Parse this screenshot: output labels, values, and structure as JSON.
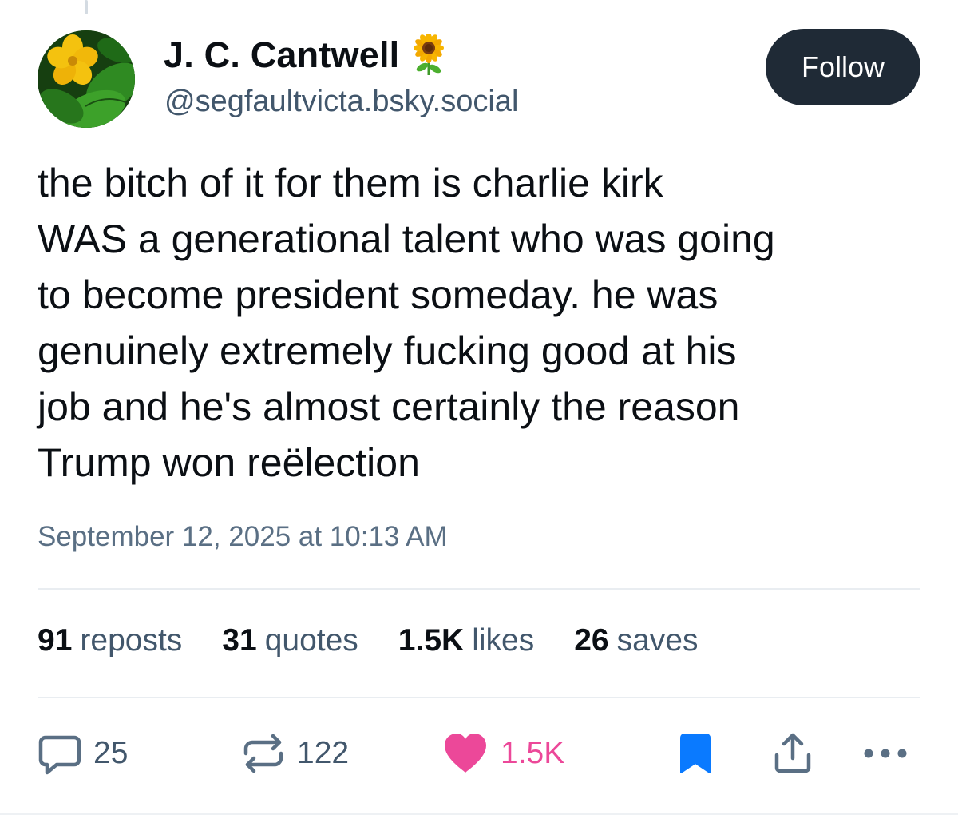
{
  "author": {
    "display_name": "J. C. Cantwell",
    "badge_emoji": "sunflower-icon",
    "handle": "@segfaultvicta.bsky.social",
    "avatar": "yellow-flower-avatar"
  },
  "follow_button": {
    "label": "Follow"
  },
  "post": {
    "text": "the bitch of it for them is charlie kirk\nWAS a generational talent who was going\nto become president someday. he was\ngenuinely extremely fucking good at his\njob and he's almost certainly the reason\nTrump won reëlection",
    "timestamp": "September 12, 2025 at 10:13 AM"
  },
  "stats": [
    {
      "count": "91",
      "label": "reposts"
    },
    {
      "count": "31",
      "label": "quotes"
    },
    {
      "count": "1.5K",
      "label": "likes"
    },
    {
      "count": "26",
      "label": "saves"
    }
  ],
  "actions": {
    "reply": {
      "icon": "reply-icon",
      "count": "25"
    },
    "repost": {
      "icon": "repost-icon",
      "count": "122"
    },
    "like": {
      "icon": "heart-icon",
      "count": "1.5K",
      "active": true
    },
    "bookmark": {
      "icon": "bookmark-icon",
      "active": true
    },
    "share": {
      "icon": "share-icon"
    },
    "more": {
      "icon": "more-icon"
    }
  },
  "colors": {
    "text_primary": "#0b0f14",
    "text_secondary": "#42576c",
    "follow_bg": "#1f2a36",
    "like_pink": "#ec4899",
    "bookmark_blue": "#0a7aff"
  }
}
